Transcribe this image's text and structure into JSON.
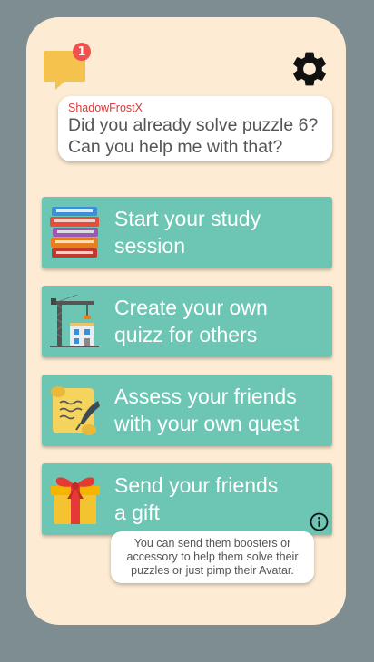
{
  "chat": {
    "icon": "chat-bubble-icon",
    "badge_count": "1"
  },
  "settings": {
    "icon": "gear-icon"
  },
  "message": {
    "sender": "ShadowFrostX",
    "text": "Did you already solve puzzle 6? Can you help me with that?"
  },
  "menu": [
    {
      "icon": "books-icon",
      "label": "Start your study\nsession"
    },
    {
      "icon": "crane-building-icon",
      "label": "Create your own\nquizz for others"
    },
    {
      "icon": "scroll-quill-icon",
      "label": "Assess your friends\nwith your own quest"
    },
    {
      "icon": "gift-icon",
      "label": "Send your friends\na gift"
    }
  ],
  "info": {
    "icon": "info-icon"
  },
  "tooltip": {
    "text": "You can send them boosters or accessory to help them solve their puzzles or just pimp their Avatar."
  },
  "colors": {
    "background": "#7d8d92",
    "card": "#fdebd3",
    "button": "#6cc6b3",
    "chat_icon": "#f5c24e",
    "badge": "#ef5350",
    "sender": "#d93a3a"
  }
}
